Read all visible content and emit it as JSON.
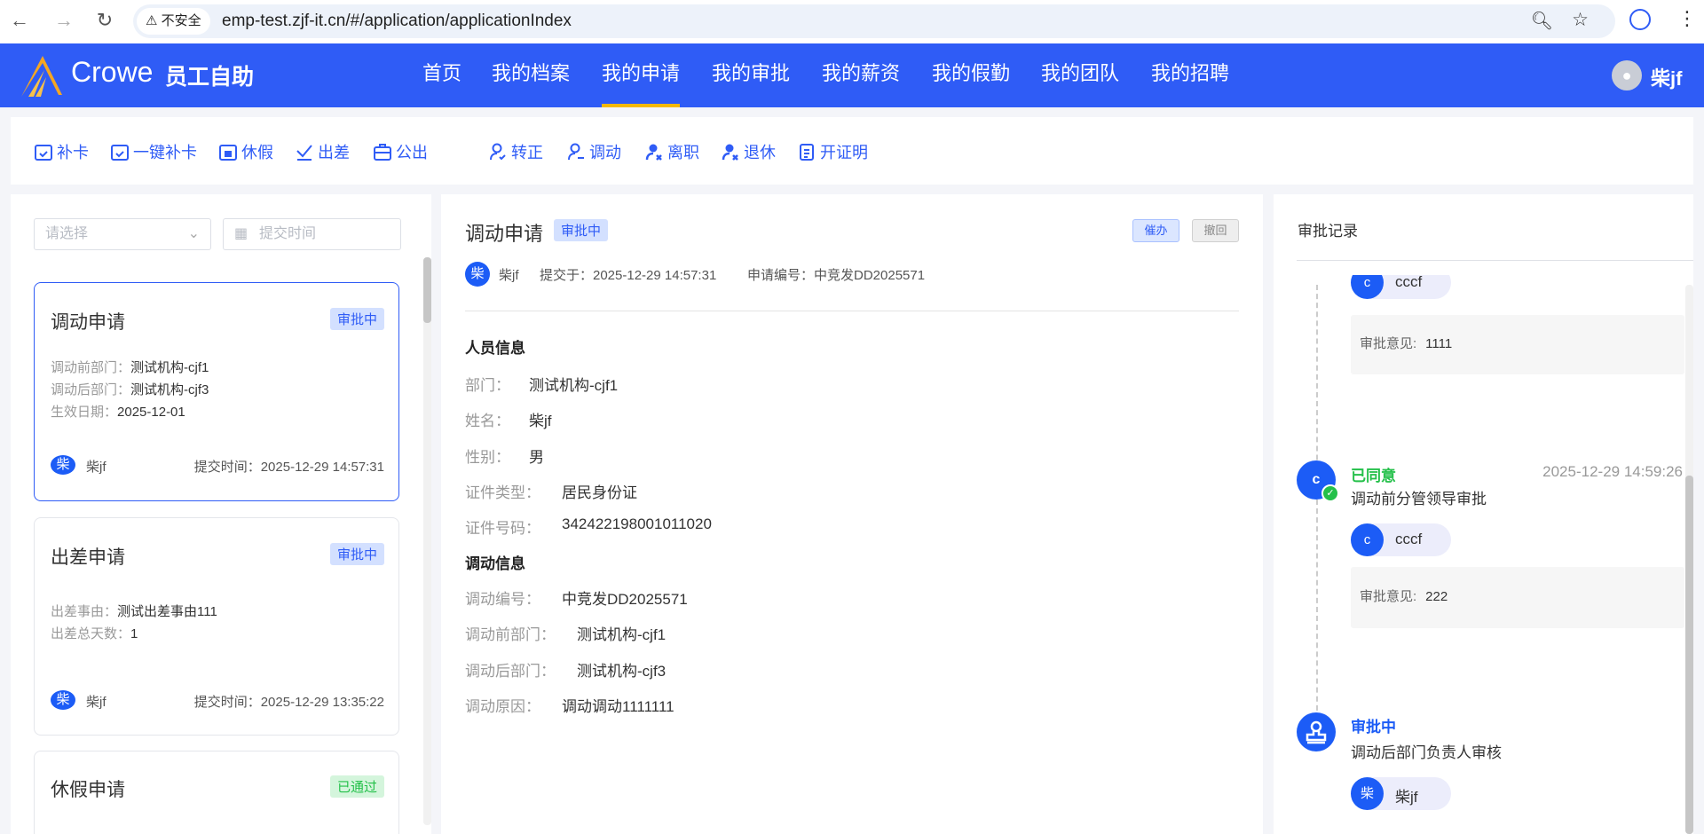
{
  "browser": {
    "security_label": "不安全",
    "url": "emp-test.zjf-it.cn/#/application/applicationIndex"
  },
  "header": {
    "brand": "Crowe",
    "app_name": "员工自助",
    "nav": [
      "首页",
      "我的档案",
      "我的申请",
      "我的审批",
      "我的薪资",
      "我的假勤",
      "我的团队",
      "我的招聘"
    ],
    "active_nav": "我的申请",
    "user": "柴jf",
    "accent": "#2f5cf6"
  },
  "toolbar": {
    "items": [
      {
        "label": "补卡",
        "icon": "calendar-check-icon"
      },
      {
        "label": "一键补卡",
        "icon": "calendar-check-icon"
      },
      {
        "label": "休假",
        "icon": "calendar-leave-icon"
      },
      {
        "label": "出差",
        "icon": "plane-icon"
      },
      {
        "label": "公出",
        "icon": "briefcase-icon"
      },
      {
        "label": "转正",
        "icon": "user-check-icon"
      },
      {
        "label": "调动",
        "icon": "user-transfer-icon"
      },
      {
        "label": "离职",
        "icon": "user-leave-icon"
      },
      {
        "label": "退休",
        "icon": "user-retire-icon"
      },
      {
        "label": "开证明",
        "icon": "document-icon"
      }
    ]
  },
  "filters": {
    "type_placeholder": "请选择",
    "date_placeholder": "提交时间"
  },
  "cards": [
    {
      "title": "调动申请",
      "status": "审批中",
      "fields": [
        {
          "label": "调动前部门：",
          "value": "测试机构-cjf1"
        },
        {
          "label": "调动后部门：",
          "value": "测试机构-cjf3"
        },
        {
          "label": "生效日期：",
          "value": "2025-12-01"
        }
      ],
      "avatar": "柴",
      "user": "柴jf",
      "submit_label": "提交时间：",
      "submit_time": "2025-12-29 14:57:31"
    },
    {
      "title": "出差申请",
      "status": "审批中",
      "fields": [
        {
          "label": "出差事由：",
          "value": "测试出差事由111"
        },
        {
          "label": "出差总天数：",
          "value": "1"
        }
      ],
      "avatar": "柴",
      "user": "柴jf",
      "submit_label": "提交时间：",
      "submit_time": "2025-12-29 13:35:22"
    },
    {
      "title": "休假申请",
      "status": "已通过"
    }
  ],
  "detail": {
    "title": "调动申请",
    "status": "审批中",
    "urge": "催办",
    "withdraw": "撤回",
    "avatar": "柴",
    "user": "柴jf",
    "submitted": "提交于：2025-12-29 14:57:31",
    "app_no": "申请编号：中竞发DD2025571",
    "section1": "人员信息",
    "person": [
      {
        "label": "部门：",
        "value": "测试机构-cjf1"
      },
      {
        "label": "姓名：",
        "value": "柴jf"
      },
      {
        "label": "性别：",
        "value": "男"
      },
      {
        "label": "证件类型：",
        "value": "居民身份证"
      },
      {
        "label": "证件号码：",
        "value": "342422198001011020"
      }
    ],
    "section2": "调动信息",
    "transfer": [
      {
        "label": "调动编号：",
        "value": "中竞发DD2025571"
      },
      {
        "label": "调动前部门：",
        "value": "测试机构-cjf1"
      },
      {
        "label": "调动后部门：",
        "value": "测试机构-cjf3"
      },
      {
        "label": "调动原因：",
        "value": "调动调动1111111"
      }
    ]
  },
  "records": {
    "title": "审批记录",
    "comment_label": "审批意见:",
    "items": [
      {
        "approver_avatar": "c",
        "approver": "cccf",
        "comment": "1111"
      },
      {
        "avatar": "c",
        "status": "已同意",
        "time": "2025-12-29 14:59:26",
        "step": "调动前分管领导审批",
        "approver_avatar": "c",
        "approver": "cccf",
        "comment": "222"
      },
      {
        "status": "审批中",
        "step": "调动后部门负责人审核",
        "approver_avatar": "柴",
        "approver": "柴jf"
      }
    ]
  }
}
